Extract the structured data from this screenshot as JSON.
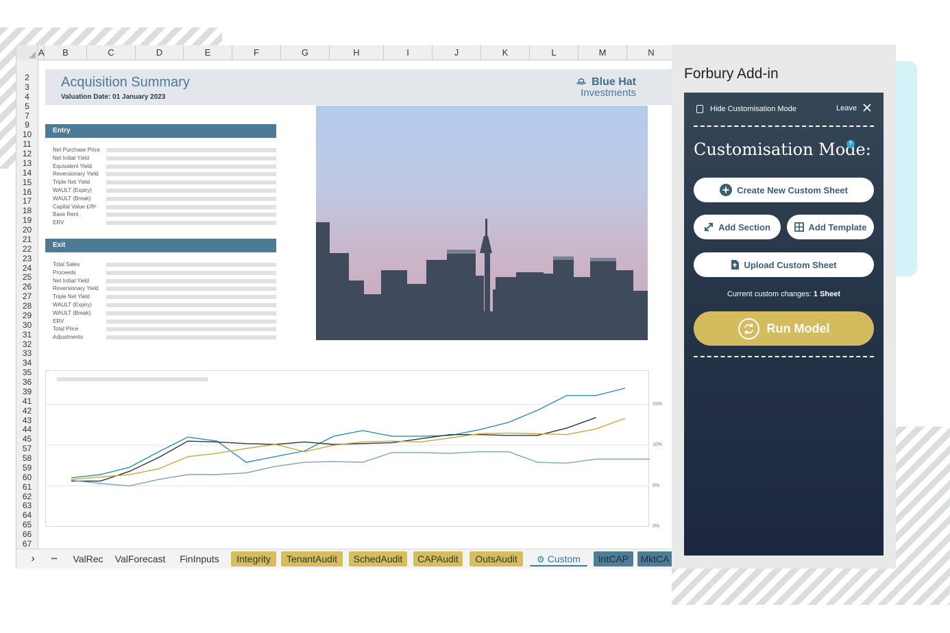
{
  "spreadsheet": {
    "columns": [
      "A",
      "B",
      "C",
      "D",
      "E",
      "F",
      "G",
      "H",
      "I",
      "J",
      "K",
      "L",
      "M",
      "N"
    ],
    "rows": [
      "2",
      "3",
      "4",
      "5",
      "7",
      "9",
      "10",
      "11",
      "12",
      "13",
      "14",
      "15",
      "16",
      "17",
      "18",
      "19",
      "20",
      "21",
      "22",
      "23",
      "24",
      "25",
      "26",
      "27",
      "28",
      "29",
      "30",
      "31",
      "32",
      "33",
      "34",
      "35",
      "36",
      "39",
      "41",
      "42",
      "43",
      "44",
      "45",
      "57",
      "58",
      "59",
      "60",
      "61",
      "62",
      "63",
      "64",
      "65",
      "66",
      "67"
    ],
    "page_title": "Acquisition Summary",
    "valuation_date": "Valuation Date: 01 January 2023",
    "logo_line1": "Blue Hat",
    "logo_line2": "Investments",
    "entry": {
      "header": "Entry",
      "labels": [
        "Net Purchase Price",
        "Net Initial Yield",
        "Equivalent Yield",
        "Reversionary Yield",
        "Triple Net Yield",
        "WAULT (Expiry)",
        "WAULT (Break)",
        "Capital Value £/ft²",
        "Base Rent",
        "ERV"
      ]
    },
    "exit": {
      "header": "Exit",
      "labels": [
        "Total Sales",
        "Proceeds",
        "Net Initial Yield",
        "Reversionary Yield",
        "Triple Net Yield",
        "WAULT (Expiry)",
        "WAULT (Break)",
        "ERV",
        "Total Price",
        "Adjustments"
      ]
    },
    "tabs": {
      "nav_next": "›",
      "more": "•••",
      "items": [
        "ValRec",
        "ValForecast",
        "FinInputs",
        "Integrity",
        "TenantAudit",
        "SchedAudit",
        "CAPAudit",
        "OutsAudit",
        "Custom",
        "IntCAP",
        "MktCA"
      ]
    }
  },
  "chart_data": {
    "type": "line",
    "x": [
      1,
      2,
      3,
      4,
      5,
      6,
      7,
      8,
      9,
      10,
      11,
      12,
      13,
      14,
      15,
      16,
      17,
      18,
      19,
      20,
      21,
      22,
      23
    ],
    "ylim": [
      0,
      17
    ],
    "y_tick_labels": [
      "0%",
      "5%",
      "10%",
      "15%"
    ],
    "grid": true,
    "series": [
      {
        "color": "#2d8fb3",
        "values": [
          6.0,
          6.4,
          7.3,
          9.2,
          11.0,
          10.5,
          7.9,
          8.6,
          9.3,
          11.1,
          11.8,
          11.1,
          11.1,
          11.2,
          11.9,
          12.8,
          14.3,
          16.1,
          16.1,
          17.0,
          null,
          null,
          null
        ]
      },
      {
        "color": "#2b3642",
        "values": [
          5.6,
          5.6,
          6.8,
          8.5,
          10.5,
          10.4,
          10.2,
          10.1,
          10.4,
          10.1,
          10.2,
          10.3,
          10.8,
          11.3,
          11.3,
          11.2,
          11.2,
          12.1,
          13.4,
          null,
          null,
          null,
          null
        ]
      },
      {
        "color": "#c9a93a",
        "values": [
          5.8,
          6.1,
          6.4,
          7.1,
          8.6,
          9.0,
          9.6,
          10.1,
          9.2,
          10.0,
          10.4,
          10.5,
          10.4,
          10.9,
          11.4,
          11.5,
          11.4,
          11.3,
          12.0,
          13.3,
          null,
          null,
          null
        ]
      },
      {
        "color": "#7ea2b8",
        "values": [
          5.7,
          5.3,
          5.0,
          5.8,
          6.4,
          6.4,
          6.6,
          7.4,
          7.9,
          8.0,
          7.9,
          9.1,
          9.1,
          9.0,
          9.2,
          9.2,
          7.9,
          7.8,
          8.3,
          8.3,
          8.3,
          null,
          null
        ]
      }
    ]
  },
  "addin": {
    "title": "Forbury Add-in",
    "hide_label": "Hide Customisation Mode",
    "leave_label": "Leave",
    "mode_title": "Customisation Mode:",
    "help": "?",
    "create_label": "Create New Custom Sheet",
    "add_section_label": "Add Section",
    "add_template_label": "Add Template",
    "upload_label": "Upload Custom Sheet",
    "changes_prefix": "Current custom changes: ",
    "changes_value": "1 Sheet",
    "run_label": "Run Model",
    "colors": {
      "gold": "#d4bc5e",
      "panel": "#273648",
      "accent": "#3a6076"
    }
  }
}
